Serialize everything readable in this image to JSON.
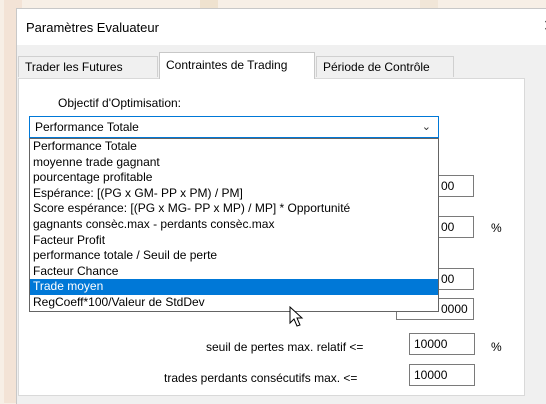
{
  "window": {
    "title": "Paramètres Evaluateur",
    "close_glyph": "✕"
  },
  "tabs": [
    {
      "label": "Trader les Futures",
      "active": false
    },
    {
      "label": "Contraintes de Trading",
      "active": true
    },
    {
      "label": "Période de Contrôle",
      "active": false
    }
  ],
  "objective": {
    "label": "Objectif d'Optimisation:",
    "selected": "Performance Totale",
    "options": [
      "Performance Totale",
      "moyenne trade gagnant",
      "pourcentage profitable",
      "Espérance: [(PG x GM- PP x PM) / PM]",
      "Score espérance: [(PG x MG- PP x MP) / MP] * Opportunité",
      "gagnants consèc.max - perdants consèc.max",
      "Facteur Profit",
      "performance totale / Seuil de perte",
      "Facteur Chance",
      "Trade moyen",
      "RegCoeff*100/Valeur de StdDev"
    ],
    "highlighted": "Trade moyen"
  },
  "constraints": {
    "partial_values": [
      "00",
      "00",
      "00",
      "0000",
      "0000"
    ],
    "percent_symbol": "%",
    "seuil_label": "seuil de pertes max. relatif  <=",
    "seuil_value": "10000",
    "losing_label": "trades perdants consécutifs max.  <=",
    "losing_value": "10000"
  },
  "colors": {
    "accent": "#0078d7",
    "panel": "#ffffff",
    "dialog": "#f0f0f0"
  }
}
